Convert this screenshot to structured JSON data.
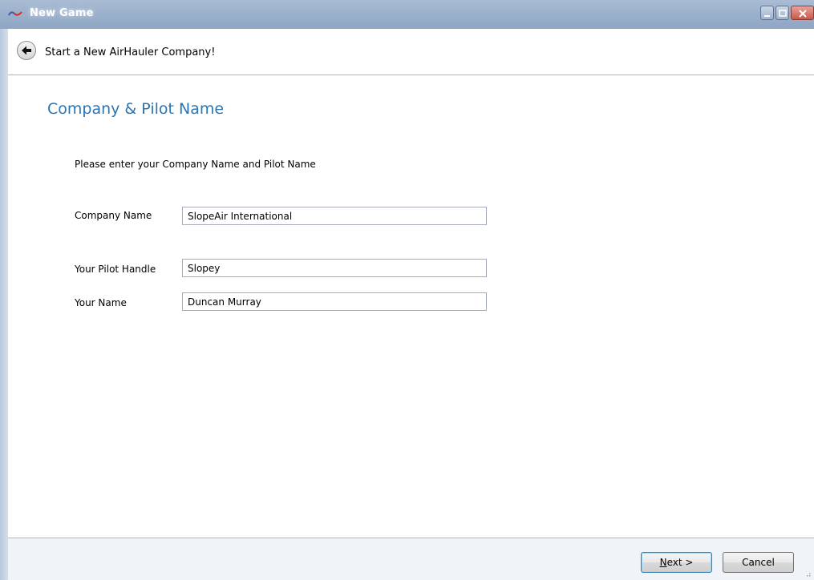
{
  "window": {
    "title": "New Game",
    "icon": "airhauler-logo-icon"
  },
  "header": {
    "back_icon": "back-arrow-icon",
    "title": "Start a New AirHauler Company!"
  },
  "content": {
    "section_title": "Company & Pilot Name",
    "instructions": "Please enter your Company Name and Pilot Name",
    "fields": {
      "company_name": {
        "label": "Company Name",
        "value": "SlopeAir International"
      },
      "pilot_handle": {
        "label": "Your Pilot Handle",
        "value": "Slopey"
      },
      "your_name": {
        "label": "Your Name",
        "value": "Duncan Murray"
      }
    }
  },
  "footer": {
    "next_mnemonic": "N",
    "next_rest": "ext >",
    "cancel_label": "Cancel"
  },
  "colors": {
    "accent": "#2a75b3",
    "titlebar": "#9cb1cc"
  }
}
